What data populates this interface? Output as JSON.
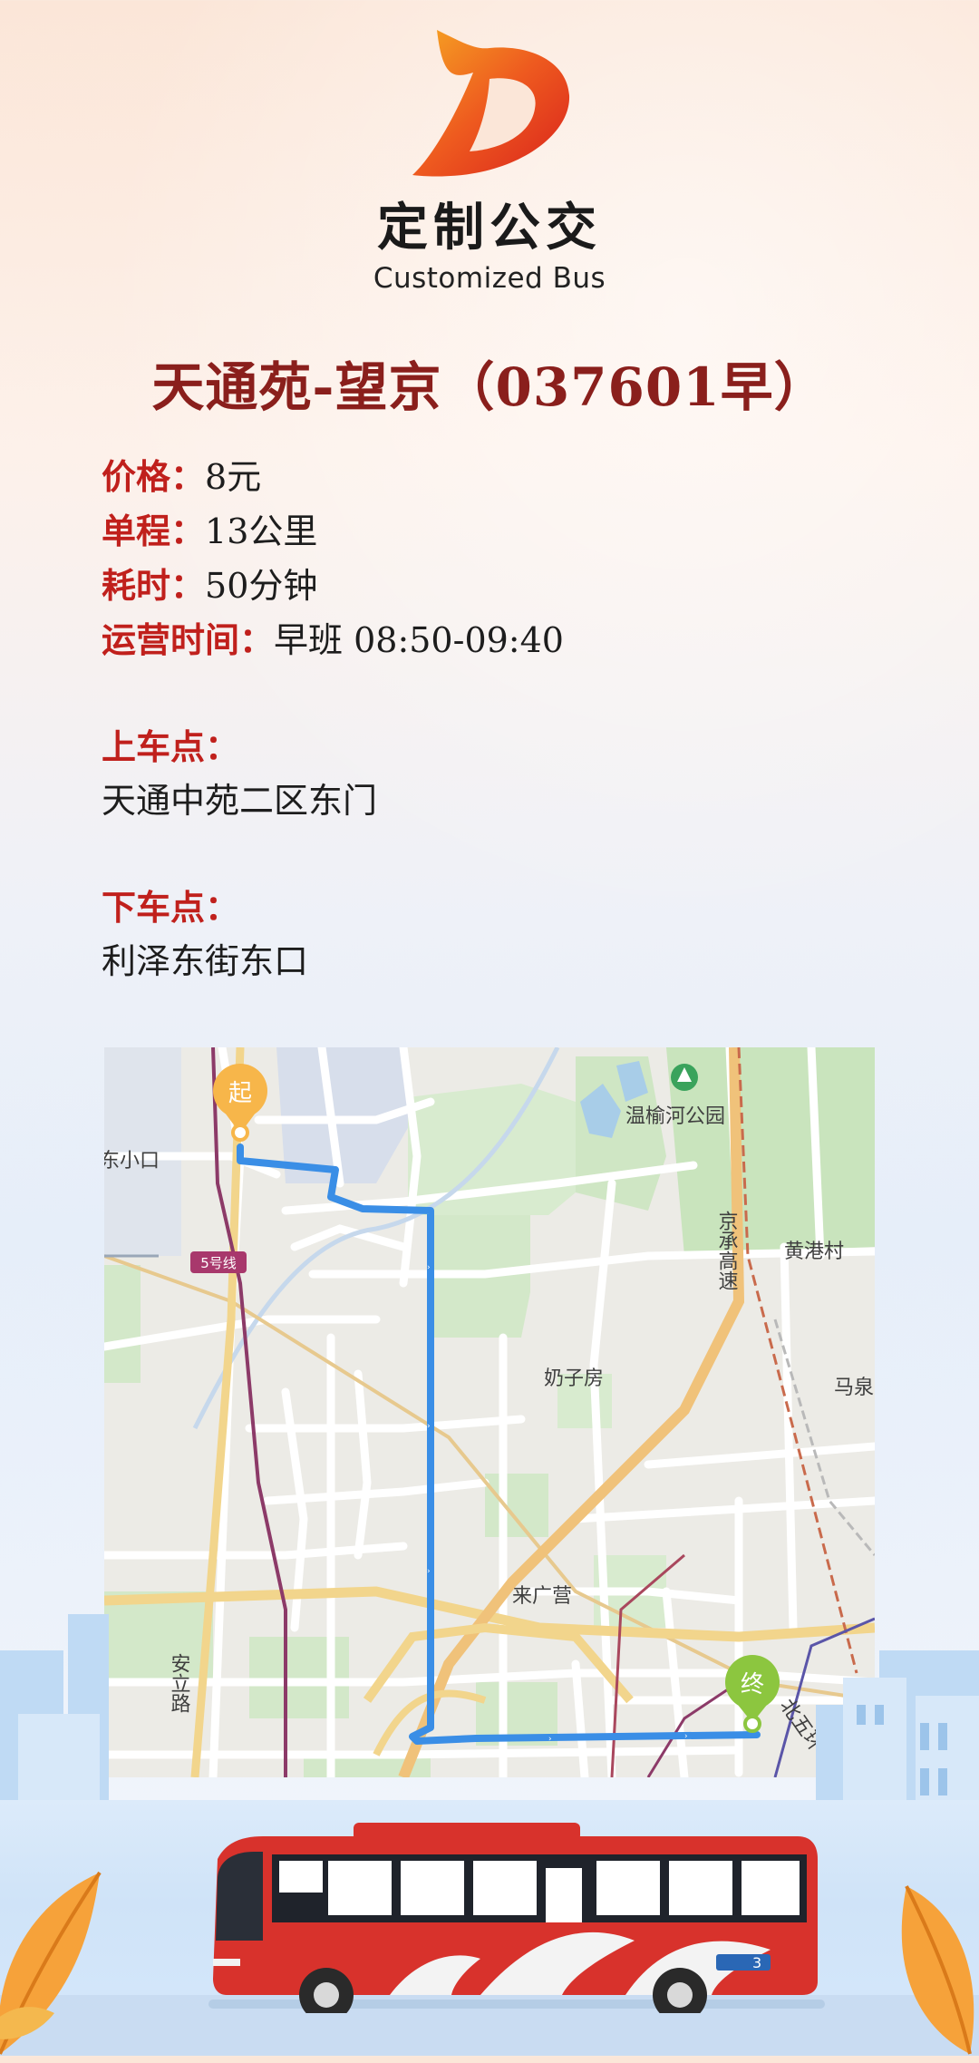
{
  "brand": {
    "name_cn": "定制公交",
    "name_en": "Customized Bus",
    "accent_color": "#e8421e"
  },
  "route": {
    "title": "天通苑-望京（037601早）"
  },
  "details": [
    {
      "label": "价格：",
      "value": "8元"
    },
    {
      "label": "单程：",
      "value": "13公里"
    },
    {
      "label": "耗时：",
      "value": "50分钟"
    },
    {
      "label": "运营时间：",
      "value": "早班 08:50-09:40"
    }
  ],
  "boarding": {
    "label": "上车点：",
    "value": "天通中苑二区东门"
  },
  "alighting": {
    "label": "下车点：",
    "value": "利泽东街东口"
  },
  "map": {
    "start_marker": "起",
    "end_marker": "终",
    "place_labels": {
      "wenyu_park": "温榆河公园",
      "xiaokou": "东小口",
      "line5": "5号线",
      "jingcheng": "京承高速",
      "huanggang": "黄港村",
      "naizifang": "奶子房",
      "maquan": "马泉",
      "laiguangying": "来广营",
      "anli_road": "安立路",
      "north_5th_ring": "北五环"
    },
    "route_color": "#3a8ee6",
    "start_color": "#f7b64a",
    "end_color": "#8cc63f"
  },
  "bus": {
    "body_color": "#d8322c",
    "route_number": "3"
  }
}
